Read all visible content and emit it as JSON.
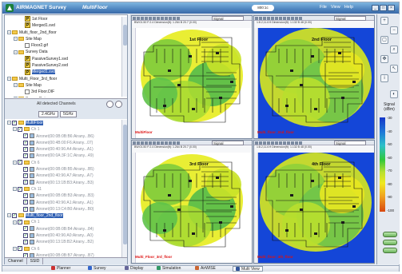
{
  "title_bar": {
    "app_name": "AIRMAGNET Survey",
    "mode": "MultiFloor",
    "zoom": "800:1c",
    "menu": [
      "File",
      "View",
      "Help"
    ]
  },
  "project_tree": [
    {
      "label": "1st Floor",
      "depth": 2,
      "icon": "project",
      "selected": false
    },
    {
      "label": "Merged1.svd",
      "depth": 2,
      "icon": "project",
      "selected": false
    },
    {
      "label": "Multi_floor_2nd_floor",
      "depth": 0,
      "icon": "folder",
      "selected": false
    },
    {
      "label": "Site Map",
      "depth": 1,
      "icon": "folder",
      "selected": false
    },
    {
      "label": "Floor2.gif",
      "depth": 2,
      "icon": "file",
      "selected": false
    },
    {
      "label": "Survey Data",
      "depth": 1,
      "icon": "folder",
      "selected": false
    },
    {
      "label": "PassiveSurvey1.svd",
      "depth": 2,
      "icon": "project",
      "selected": false
    },
    {
      "label": "PassiveSurvey2.svd",
      "depth": 2,
      "icon": "project",
      "selected": false
    },
    {
      "label": "Merged1.svd",
      "depth": 2,
      "icon": "project",
      "selected": true
    },
    {
      "label": "Multi_Floor_3rd_floor",
      "depth": 0,
      "icon": "folder",
      "selected": false
    },
    {
      "label": "Site Map",
      "depth": 1,
      "icon": "folder",
      "selected": false
    },
    {
      "label": "3rd Floor.DIF",
      "depth": 2,
      "icon": "file",
      "selected": false
    },
    {
      "label": "Survey Data",
      "depth": 1,
      "icon": "folder",
      "selected": false
    }
  ],
  "channels": {
    "header": "All detected Channels",
    "bands": [
      "2.4GHz",
      "5GHz"
    ]
  },
  "channel_tree": [
    {
      "label": "MultiFloor",
      "depth": 0,
      "sel": true
    },
    {
      "label": "Ch 1",
      "depth": 1,
      "dim": true
    },
    {
      "label": "Aironet(00:0B:0B:B6:Airany...B6)",
      "depth": 2
    },
    {
      "label": "Aironet(00:4B:00:F6:Airany...07)",
      "depth": 2
    },
    {
      "label": "Aironet(00:40:96:A4:Airany...A1)",
      "depth": 2
    },
    {
      "label": "Aironet(00:0A:3F:1C:Airany...49)",
      "depth": 2
    },
    {
      "label": "Ch 6",
      "depth": 1,
      "dim": true
    },
    {
      "label": "Aironet(00:0B:0B:B5:Airany...B5)",
      "depth": 2
    },
    {
      "label": "Aironet(00:40:96:A7:Airany...A7)",
      "depth": 2
    },
    {
      "label": "Aironet(00:13:1B:B3:Airany...B3)",
      "depth": 2
    },
    {
      "label": "Ch 11",
      "depth": 1,
      "dim": true
    },
    {
      "label": "Aironet(00:0B:0B:B3:Airany...B3)",
      "depth": 2
    },
    {
      "label": "Aironet(00:40:96:A1:Airany...A1)",
      "depth": 2
    },
    {
      "label": "Aironet(00:13:C4:B0:Airany...B0)",
      "depth": 2
    },
    {
      "label": "Multi_floor_2nd_floor",
      "depth": 0,
      "sel": true
    },
    {
      "label": "Ch 1",
      "depth": 1,
      "dim": true
    },
    {
      "label": "Aironet(00:0B:0B:B4:Airany...84)",
      "depth": 2
    },
    {
      "label": "Aironet(00:40:96:A0:Airany...A0)",
      "depth": 2
    },
    {
      "label": "Aironet(00:13:1B:B2:Airany...B2)",
      "depth": 2
    },
    {
      "label": "Ch 6",
      "depth": 1,
      "dim": true
    },
    {
      "label": "Aironet(00:0B:0B:B7:Airany...B7)",
      "depth": 2
    }
  ],
  "left_tabs": [
    "Channel",
    "SSID"
  ],
  "maps": [
    {
      "floor": "1st Floor",
      "label": "MultiFloor",
      "info": "BW:01.50 F:2.4  Dimension(ft): 1.264  B 20.7 (0.00)",
      "signal": "Signal",
      "bg": "#ffffff"
    },
    {
      "floor": "2nd Floor",
      "label": "Multi_floor_2nd_floor",
      "info": "1:8.2,11.6 ft  Dimension(ft): 1.132  B 48 (0.00)",
      "signal": "Signal",
      "bg": "#1446d8"
    },
    {
      "floor": "3rd Floor",
      "label": "Multi_Floor_3rd_floor",
      "info": "BW:01.50 F:2.4  Dimension(ft): 1.264  B 20.7 (0.00)",
      "signal": "Signal",
      "bg": "#ffffff"
    },
    {
      "floor": "4th Floor",
      "label": "Multi_floor_4th_floor",
      "info": "1:8.2,11.6 ft  Dimension(ft): 1.132  B 48 (0.00)",
      "signal": "Signal",
      "bg": "#1446d8"
    }
  ],
  "legend": {
    "title": "Signal (dBm)",
    "ticks": [
      "-30",
      "-40",
      "-50",
      "-60",
      "-70",
      "-80",
      "-90",
      "-100"
    ]
  },
  "status_bar": [
    {
      "label": "Planner",
      "icon_color": "#cc3333"
    },
    {
      "label": "Survey",
      "icon_color": "#3366cc"
    },
    {
      "label": "Display",
      "icon_color": "#666699"
    },
    {
      "label": "Simulation",
      "icon_color": "#339966"
    },
    {
      "label": "AirWISE",
      "icon_color": "#cc6633"
    },
    {
      "label": "Multi View",
      "icon_color": "#335599",
      "active": true
    }
  ]
}
